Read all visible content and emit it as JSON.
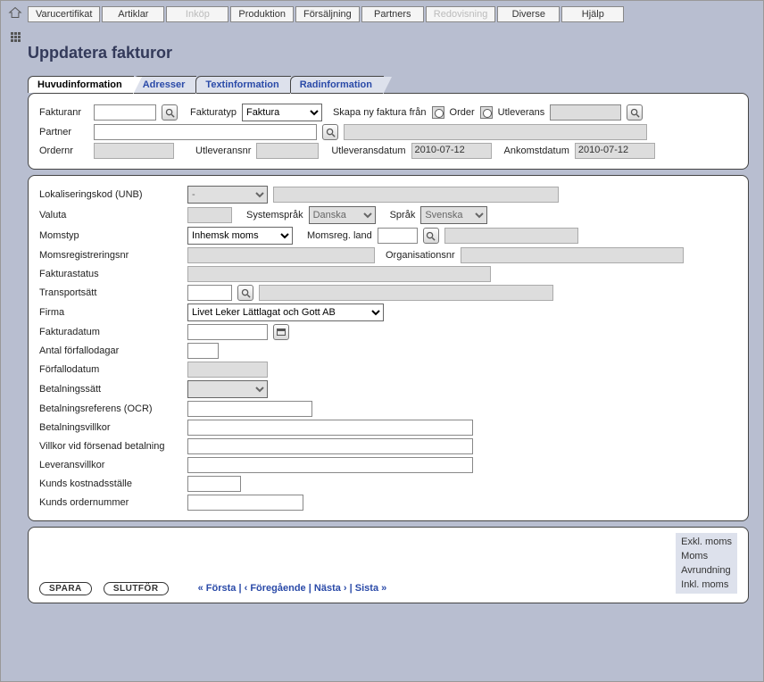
{
  "menu": [
    "Varucertifikat",
    "Artiklar",
    "Inköp",
    "Produktion",
    "Försäljning",
    "Partners",
    "Redovisning",
    "Diverse",
    "Hjälp"
  ],
  "menu_disabled": [
    2,
    6
  ],
  "title": "Uppdatera fakturor",
  "tabs": [
    "Huvudinformation",
    "Adresser",
    "Textinformation",
    "Radinformation"
  ],
  "top": {
    "fakturanr": "Fakturanr",
    "fakturatyp": "Fakturatyp",
    "fakturatyp_val": "Faktura",
    "skapa": "Skapa ny faktura från",
    "order": "Order",
    "utleverans": "Utleverans",
    "partner": "Partner",
    "ordernr": "Ordernr",
    "utleveransnr": "Utleveransnr",
    "utleveransdatum": "Utleveransdatum",
    "utleveransdatum_val": "2010-07-12",
    "ankomstdatum": "Ankomstdatum",
    "ankomstdatum_val": "2010-07-12"
  },
  "main": {
    "lokaliseringskod": "Lokaliseringskod (UNB)",
    "lokaliseringskod_val": "-",
    "valuta": "Valuta",
    "systemsprak": "Systemspråk",
    "systemsprak_val": "Danska",
    "sprak": "Språk",
    "sprak_val": "Svenska",
    "momstyp": "Momstyp",
    "momstyp_val": "Inhemsk moms",
    "momsreg_land": "Momsreg. land",
    "momsregistreringsnr": "Momsregistreringsnr",
    "organisationsnr": "Organisationsnr",
    "fakturastatus": "Fakturastatus",
    "transportsatt": "Transportsätt",
    "firma": "Firma",
    "firma_val": "Livet Leker Lättlagat och Gott AB",
    "fakturadatum": "Fakturadatum",
    "antal_forfallodagar": "Antal förfallodagar",
    "forfallodatum": "Förfallodatum",
    "betalningssatt": "Betalningssätt",
    "betalningsreferens": "Betalningsreferens (OCR)",
    "betalningsvillkor": "Betalningsvillkor",
    "villkor_forsenad": "Villkor vid försenad betalning",
    "leveransvillkor": "Leveransvillkor",
    "kunds_kostnad": "Kunds kostnadsställe",
    "kunds_ordernr": "Kunds ordernummer"
  },
  "footer": {
    "spara": "SPARA",
    "slutfor": "SLUTFÖR",
    "pager_first": "« Första",
    "pager_prev": "‹ Föregående",
    "pager_next": "Nästa ›",
    "pager_last": "Sista »",
    "totals": [
      "Exkl. moms",
      "Moms",
      "Avrundning",
      "Inkl. moms"
    ]
  }
}
